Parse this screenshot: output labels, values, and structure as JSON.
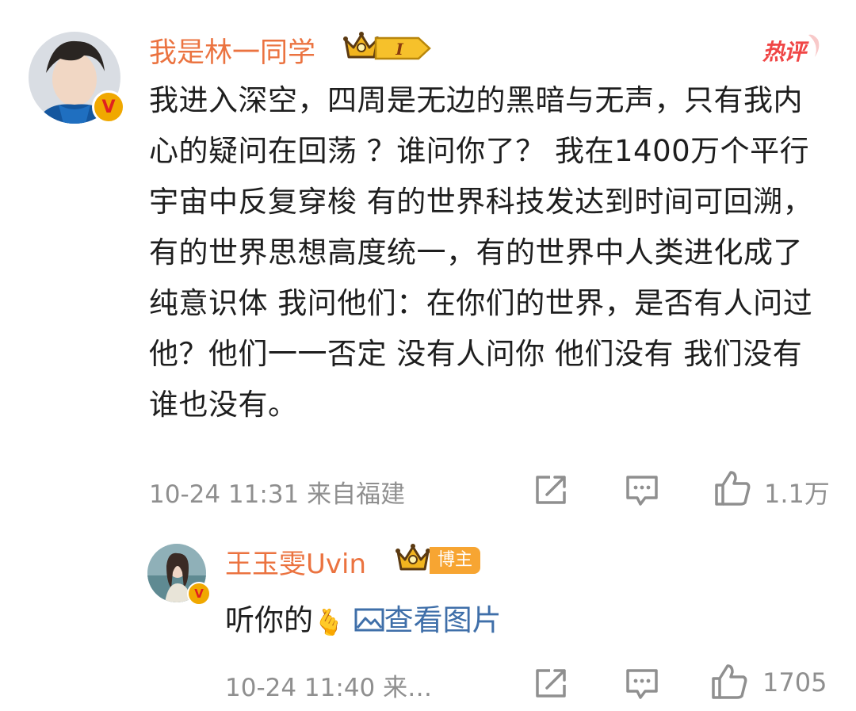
{
  "main_comment": {
    "username": "我是林一同学",
    "level_label": "I",
    "hot_label": "热评",
    "text": "我进入深空，四周是无边的黑暗与无声，只有我内心的疑问在回荡 ？谁问你了？ 我在1400万个平行宇宙中反复穿梭 有的世界科技发达到时间可回溯，有的世界思想高度统一，有的世界中人类进化成了纯意识体 我问他们：在你们的世界，是否有人问过他？他们一一否定 没有人问你 他们没有 我们没有 谁也没有。",
    "meta": "10-24 11:31  来自福建",
    "like_count": "1.1万",
    "verified_mark": "V"
  },
  "reply": {
    "username": "王玉雯Uvin",
    "role_badge": "博主",
    "text": "听你的",
    "emoji": "🫰",
    "view_image_label": "查看图片",
    "meta": "10-24 11:40  来…",
    "like_count": "1705",
    "verified_mark": "V"
  },
  "icons": {
    "share": "share-icon",
    "comment": "comment-icon",
    "like": "thumbs-up-icon",
    "image": "image-icon",
    "crown": "crown-icon"
  },
  "colors": {
    "username": "#eb7340",
    "meta": "#8f8f8f",
    "link": "#3f6fa9",
    "hot": "#f04646",
    "gold": "#f7a532"
  }
}
